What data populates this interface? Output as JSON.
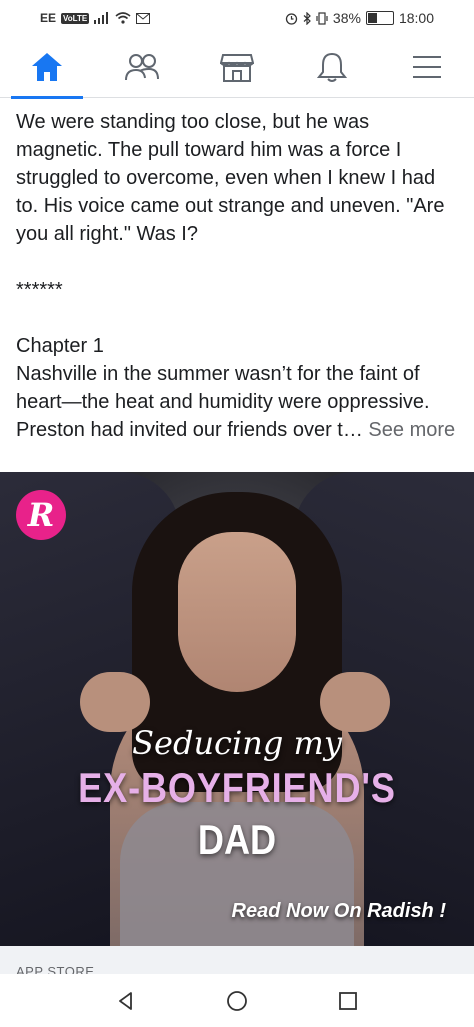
{
  "status_bar": {
    "carrier": "EE",
    "volte": "VoLTE",
    "battery": "38%",
    "battery_level": 0.38,
    "time": "18:00"
  },
  "nav": {
    "items": [
      {
        "name": "home",
        "icon": "home-icon",
        "active": true
      },
      {
        "name": "friends",
        "icon": "friends-icon",
        "active": false
      },
      {
        "name": "marketplace",
        "icon": "marketplace-icon",
        "active": false
      },
      {
        "name": "notifications",
        "icon": "bell-icon",
        "active": false
      },
      {
        "name": "menu",
        "icon": "menu-icon",
        "active": false
      }
    ],
    "accent": "#1877f2"
  },
  "post": {
    "paragraph1": "We were standing too close, but he was magnetic. The pull toward him was a force I struggled to overcome, even when I knew I had to. His voice came out strange and uneven. \"Are you all right.\" Was I?",
    "separator": "******",
    "chapter": "Chapter 1",
    "paragraph2": "Nashville in the summer wasn’t for the faint of heart—the heat and humidity were oppressive. Preston had invited our friends over t…",
    "see_more": "See more"
  },
  "ad": {
    "logo_letter": "R",
    "title_line1": "Seducing my",
    "title_line2": "EX-BOYFRIEND'S",
    "title_line3": "DAD",
    "cta": "Read Now On Radish !"
  },
  "app_store": {
    "label": "APP STORE"
  },
  "system_nav": {
    "back": "back-icon",
    "home": "home-circle-icon",
    "recents": "recents-icon"
  }
}
